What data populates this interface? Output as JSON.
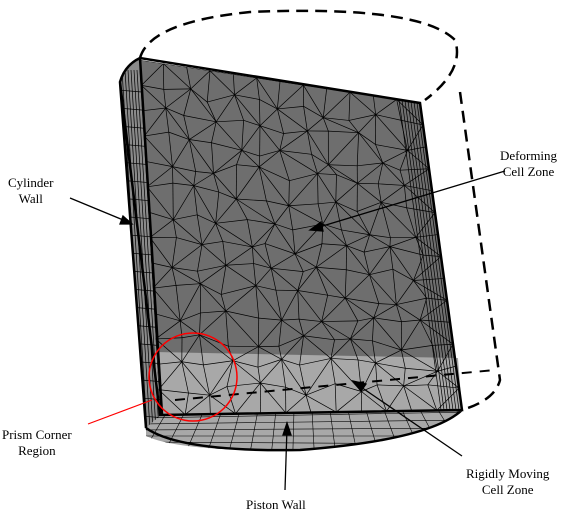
{
  "labels": {
    "cylinder_wall": "Cylinder\nWall",
    "deforming_zone": "Deforming\nCell Zone",
    "prism_corner": "Prism Corner\nRegion",
    "piston_wall": "Piston Wall",
    "rigid_zone": "Rigidly Moving\nCell Zone"
  },
  "colors": {
    "deforming_face": "#6e6e6e",
    "rigid_face": "#a8a8a8",
    "side_wall": "#8a8a8a",
    "highlight_circle": "#ff0000",
    "mesh_lines": "#000000"
  }
}
